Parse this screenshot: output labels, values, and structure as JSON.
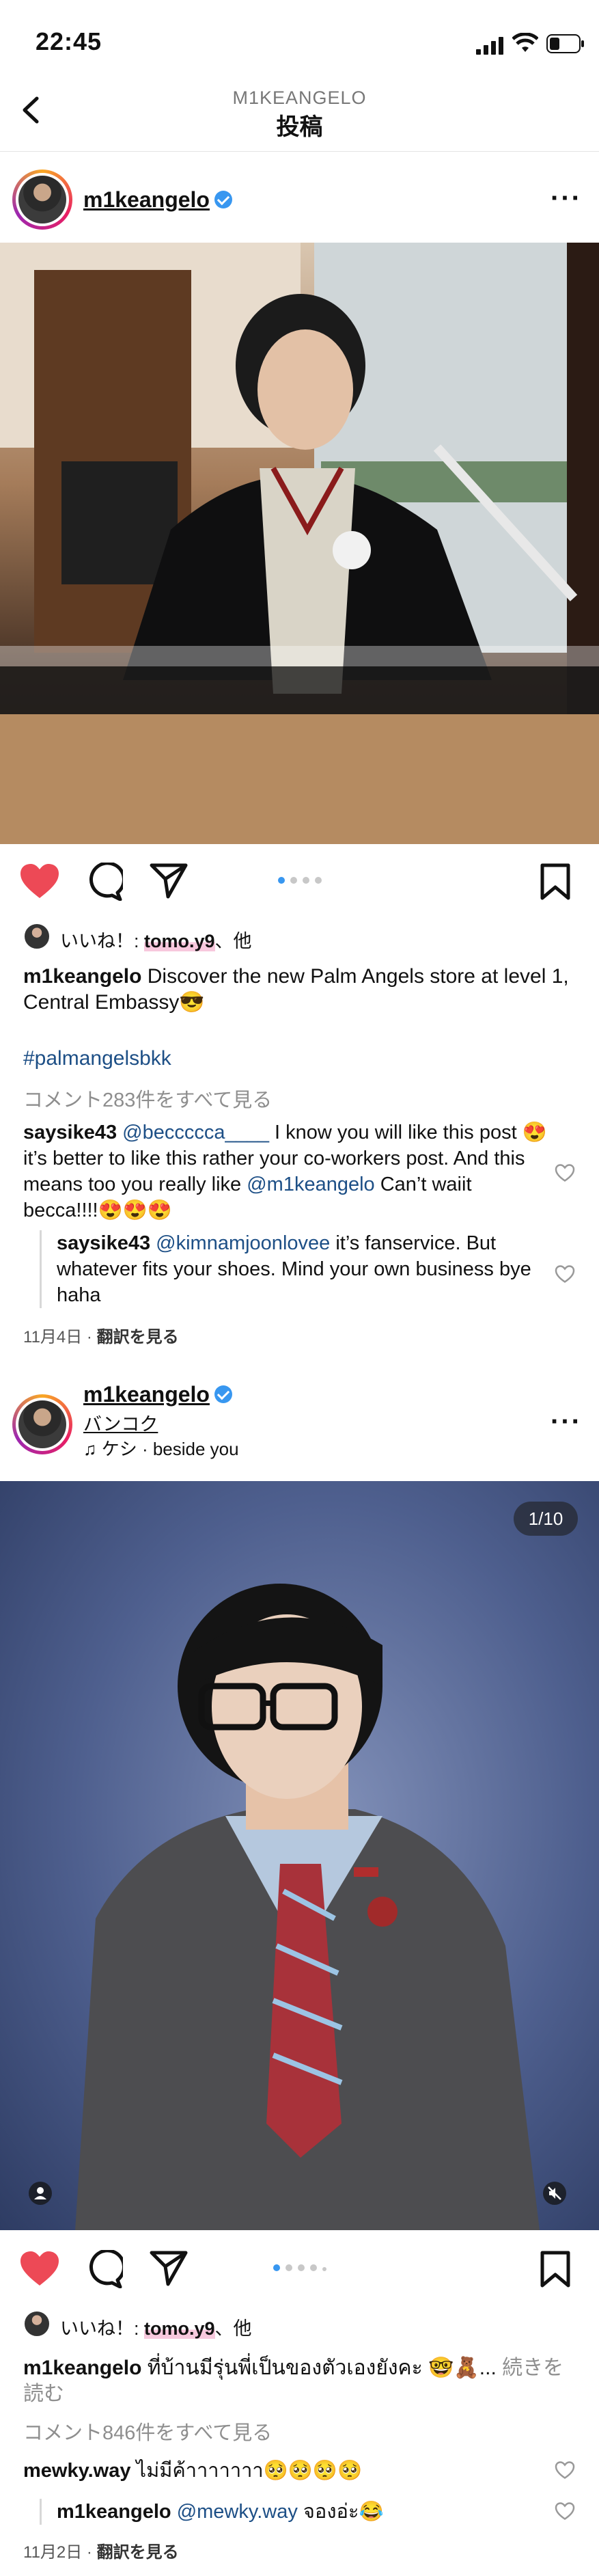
{
  "status_bar": {
    "time": "22:45"
  },
  "nav": {
    "username": "M1KEANGELO",
    "title": "投稿"
  },
  "post1": {
    "username": "m1keangelo",
    "liked_by": {
      "prefix": "いいね！: ",
      "user": "tomo.y9",
      "suffix": "、他"
    },
    "caption": {
      "user": "m1keangelo",
      "text": " Discover the new Palm Angels store at level 1, Central Embassy😎"
    },
    "hashtag": "#palmangelsbkk",
    "view_all": "コメント283件をすべて見る",
    "comments": [
      {
        "user": "saysike43",
        "mention": "@beccccca____",
        "text": " I know you will like this post 😍 it’s better to like this rather your co-workers post. And this means too you really like ",
        "mention2": "@m1keangelo",
        "text2": " Can’t waiit becca!!!!😍😍😍"
      },
      {
        "user": "saysike43",
        "mention": "@kimnamjoonlovee",
        "text": " it’s fanservice. But whatever fits your shoes. Mind your own business bye haha"
      }
    ],
    "date": "11月4日",
    "translate": "翻訳を見る",
    "carousel": {
      "count": 4,
      "active": 0
    }
  },
  "post2": {
    "username": "m1keangelo",
    "location": "バンコク",
    "music": "ケシ · beside you",
    "counter": "1/10",
    "liked_by": {
      "prefix": "いいね！: ",
      "user": "tomo.y9",
      "suffix": "、他"
    },
    "caption": {
      "user": "m1keangelo",
      "text": " ที่บ้านมีรุ่นพี่เป็นของตัวเองยังคะ 🤓🧸... ",
      "more": "続きを読む"
    },
    "view_all": "コメント846件をすべて見る",
    "comments": [
      {
        "user": "mewky.way",
        "text": " ไม่มีค้าาาาาาา🥺🥺🥺🥺"
      },
      {
        "user": "m1keangelo",
        "mention": "@mewky.way",
        "text": " จองอ่ะ😂"
      }
    ],
    "date": "11月2日",
    "translate": "翻訳を見る",
    "carousel": {
      "count": 5,
      "active": 0
    }
  },
  "colors": {
    "like": "#ed4956",
    "verified": "#3897f0",
    "link": "#1d4f86",
    "dot_active": "#3897f0"
  },
  "icons": [
    "back-icon",
    "more-icon",
    "verified-icon",
    "heart-icon",
    "comment-icon",
    "share-icon",
    "bookmark-icon",
    "music-icon",
    "user-tag-icon",
    "mute-icon"
  ]
}
